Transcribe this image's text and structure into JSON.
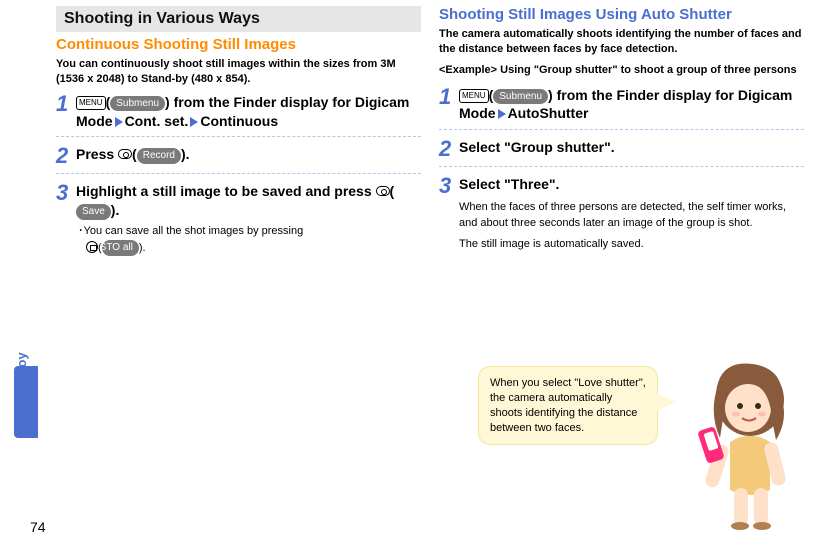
{
  "sidebar_label": "Enjoy",
  "page_number": "74",
  "left": {
    "section_title": "Shooting in Various Ways",
    "subheading": "Continuous Shooting Still Images",
    "intro": "You can continuously shoot still images within the sizes from 3M (1536 x 2048) to Stand-by (480 x 854).",
    "steps": [
      {
        "num": "1",
        "menu_key": "MENU",
        "menu_btn": "Submenu",
        "title_a": "(",
        "title_b": ") from the Finder display for Digicam Mode",
        "title_c": "Cont. set.",
        "title_d": "Continuous"
      },
      {
        "num": "2",
        "title_a": "Press ",
        "btn": "Record",
        "title_b": "(",
        "title_c": ")."
      },
      {
        "num": "3",
        "title": "Highlight a still image to be saved and press ",
        "btn": "Save",
        "title_b": "(",
        "title_c": ").",
        "bullet": "･You can save all the shot images by pressing ",
        "bullet_btn": "STO all",
        "bullet_b": "(",
        "bullet_c": ")."
      }
    ]
  },
  "right": {
    "subheading": "Shooting Still Images Using Auto Shutter",
    "intro": "The camera automatically shoots identifying the number of faces and the distance between faces by face detection.",
    "example_label": "<Example>",
    "example_text": "Using \"Group shutter\" to shoot a group of three persons",
    "steps": [
      {
        "num": "1",
        "menu_key": "MENU",
        "menu_btn": "Submenu",
        "title_a": "(",
        "title_b": ") from the Finder display for Digicam Mode",
        "title_c": "AutoShutter"
      },
      {
        "num": "2",
        "title": "Select \"Group shutter\"."
      },
      {
        "num": "3",
        "title": "Select \"Three\".",
        "note1": "When the faces of three persons are detected, the self timer works, and about three seconds later an image of the group is shot.",
        "note2": "The still image is automatically saved."
      }
    ],
    "callout": "When you select \"Love shutter\", the camera automatically shoots identifying the distance between two faces."
  }
}
